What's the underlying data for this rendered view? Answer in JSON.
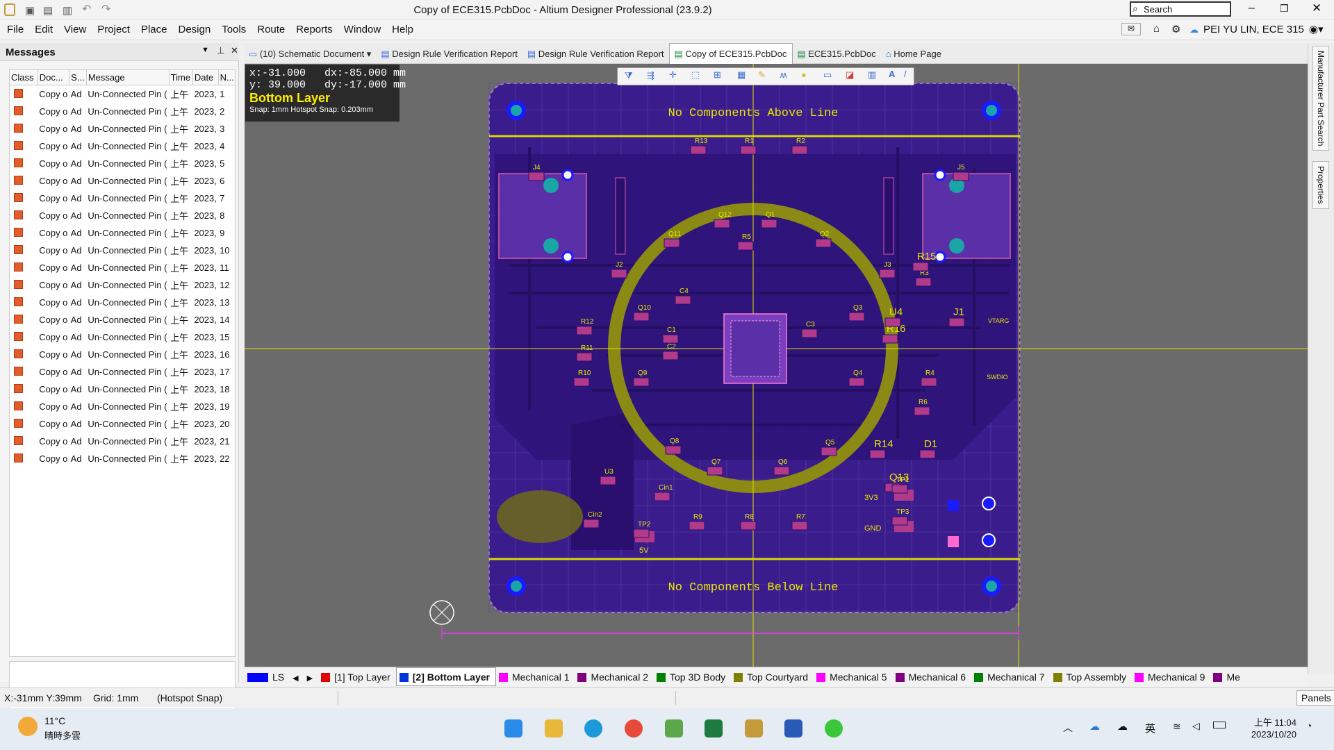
{
  "window": {
    "title": "Copy of ECE315.PcbDoc - Altium Designer Professional (23.9.2)",
    "search_placeholder": "Search"
  },
  "menu": [
    "File",
    "Edit",
    "View",
    "Project",
    "Place",
    "Design",
    "Tools",
    "Route",
    "Reports",
    "Window",
    "Help"
  ],
  "user": "PEI YU LIN, ECE 315",
  "messages_panel": {
    "title": "Messages",
    "columns": [
      "Class",
      "Doc...",
      "S...",
      "Message",
      "Time",
      "Date",
      "N..."
    ],
    "rows": [
      {
        "doc": "Copy o",
        "src": "Ad",
        "msg": "Un-Connected Pin (",
        "time": "上午",
        "date": "2023,",
        "n": "1"
      },
      {
        "doc": "Copy o",
        "src": "Ad",
        "msg": "Un-Connected Pin (",
        "time": "上午",
        "date": "2023,",
        "n": "2"
      },
      {
        "doc": "Copy o",
        "src": "Ad",
        "msg": "Un-Connected Pin (",
        "time": "上午",
        "date": "2023,",
        "n": "3"
      },
      {
        "doc": "Copy o",
        "src": "Ad",
        "msg": "Un-Connected Pin (",
        "time": "上午",
        "date": "2023,",
        "n": "4"
      },
      {
        "doc": "Copy o",
        "src": "Ad",
        "msg": "Un-Connected Pin (",
        "time": "上午",
        "date": "2023,",
        "n": "5"
      },
      {
        "doc": "Copy o",
        "src": "Ad",
        "msg": "Un-Connected Pin (",
        "time": "上午",
        "date": "2023,",
        "n": "6"
      },
      {
        "doc": "Copy o",
        "src": "Ad",
        "msg": "Un-Connected Pin (",
        "time": "上午",
        "date": "2023,",
        "n": "7"
      },
      {
        "doc": "Copy o",
        "src": "Ad",
        "msg": "Un-Connected Pin (",
        "time": "上午",
        "date": "2023,",
        "n": "8"
      },
      {
        "doc": "Copy o",
        "src": "Ad",
        "msg": "Un-Connected Pin (",
        "time": "上午",
        "date": "2023,",
        "n": "9"
      },
      {
        "doc": "Copy o",
        "src": "Ad",
        "msg": "Un-Connected Pin (",
        "time": "上午",
        "date": "2023,",
        "n": "10"
      },
      {
        "doc": "Copy o",
        "src": "Ad",
        "msg": "Un-Connected Pin (",
        "time": "上午",
        "date": "2023,",
        "n": "11"
      },
      {
        "doc": "Copy o",
        "src": "Ad",
        "msg": "Un-Connected Pin (",
        "time": "上午",
        "date": "2023,",
        "n": "12"
      },
      {
        "doc": "Copy o",
        "src": "Ad",
        "msg": "Un-Connected Pin (",
        "time": "上午",
        "date": "2023,",
        "n": "13"
      },
      {
        "doc": "Copy o",
        "src": "Ad",
        "msg": "Un-Connected Pin (",
        "time": "上午",
        "date": "2023,",
        "n": "14"
      },
      {
        "doc": "Copy o",
        "src": "Ad",
        "msg": "Un-Connected Pin (",
        "time": "上午",
        "date": "2023,",
        "n": "15"
      },
      {
        "doc": "Copy o",
        "src": "Ad",
        "msg": "Un-Connected Pin (",
        "time": "上午",
        "date": "2023,",
        "n": "16"
      },
      {
        "doc": "Copy o",
        "src": "Ad",
        "msg": "Un-Connected Pin (",
        "time": "上午",
        "date": "2023,",
        "n": "17"
      },
      {
        "doc": "Copy o",
        "src": "Ad",
        "msg": "Un-Connected Pin (",
        "time": "上午",
        "date": "2023,",
        "n": "18"
      },
      {
        "doc": "Copy o",
        "src": "Ad",
        "msg": "Un-Connected Pin (",
        "time": "上午",
        "date": "2023,",
        "n": "19"
      },
      {
        "doc": "Copy o",
        "src": "Ad",
        "msg": "Un-Connected Pin (",
        "time": "上午",
        "date": "2023,",
        "n": "20"
      },
      {
        "doc": "Copy o",
        "src": "Ad",
        "msg": "Un-Connected Pin (",
        "time": "上午",
        "date": "2023,",
        "n": "21"
      },
      {
        "doc": "Copy o",
        "src": "Ad",
        "msg": "Un-Connected Pin (",
        "time": "上午",
        "date": "2023,",
        "n": "22"
      }
    ]
  },
  "doc_tabs": [
    {
      "label": "(10) Schematic Document",
      "active": false
    },
    {
      "label": "Design Rule Verification Report",
      "active": false
    },
    {
      "label": "Design Rule Verification Report",
      "active": false
    },
    {
      "label": "Copy of ECE315.PcbDoc",
      "active": true
    },
    {
      "label": "ECE315.PcbDoc",
      "active": false
    },
    {
      "label": "Home Page",
      "active": false
    }
  ],
  "hud": {
    "line1": "x:-31.000   dx:-85.000 mm",
    "line2": "y: 39.000   dy:-17.000 mm",
    "layer": "Bottom Layer",
    "snap": "Snap: 1mm Hotspot Snap: 0.203mm"
  },
  "board": {
    "top_text": "No Components Above Line",
    "bottom_text": "No Components Below Line",
    "designators": [
      "J4",
      "J5",
      "J2",
      "J3",
      "J1",
      "R13",
      "R1",
      "R2",
      "R3",
      "R4",
      "R5",
      "R6",
      "R7",
      "R8",
      "R9",
      "R10",
      "R11",
      "R12",
      "R14",
      "R15",
      "R16",
      "Q1",
      "Q2",
      "Q3",
      "Q4",
      "Q5",
      "Q6",
      "Q7",
      "Q8",
      "Q9",
      "Q10",
      "Q11",
      "Q12",
      "Q13",
      "C1",
      "C2",
      "C3",
      "C4",
      "U3",
      "U4",
      "D1",
      "TP1",
      "TP2",
      "TP3",
      "Cin1",
      "Cin2"
    ],
    "net_labels": [
      "3V3",
      "GND",
      "5V",
      "VTARG",
      "SWDIO"
    ]
  },
  "right_side_tabs": [
    "Manufacturer Part Search",
    "Properties"
  ],
  "layer_tabs": [
    {
      "label": "LS",
      "color": "#0000ff"
    },
    {
      "label": "[1] Top Layer",
      "color": "#e00000"
    },
    {
      "label": "[2] Bottom Layer",
      "color": "#0033dd",
      "active": true
    },
    {
      "label": "Mechanical 1",
      "color": "#ff00ff"
    },
    {
      "label": "Mechanical 2",
      "color": "#800080"
    },
    {
      "label": "Top 3D Body",
      "color": "#008000"
    },
    {
      "label": "Top Courtyard",
      "color": "#808000"
    },
    {
      "label": "Mechanical 5",
      "color": "#ff00ff"
    },
    {
      "label": "Mechanical 6",
      "color": "#800080"
    },
    {
      "label": "Mechanical 7",
      "color": "#008000"
    },
    {
      "label": "Top Assembly",
      "color": "#808000"
    },
    {
      "label": "Mechanical 9",
      "color": "#ff00ff"
    },
    {
      "label": "Me",
      "color": "#800080"
    }
  ],
  "status": {
    "coords": "X:-31mm Y:39mm",
    "grid": "Grid: 1mm",
    "snap": "(Hotspot Snap)",
    "panels": "Panels"
  },
  "taskbar": {
    "weather_temp": "11°C",
    "weather_desc": "晴時多雲",
    "ime": "英",
    "time": "上午 11:04",
    "date": "2023/10/20"
  },
  "colors": {
    "board": "#3b1c8c",
    "board_dark": "#2a0f6e",
    "keepout": "#d8d800",
    "ring": "#8a8a14",
    "pad_teal": "#1aa6a6",
    "via_blue": "#1a1aff",
    "label_yellow": "#e8e800",
    "hud_layer": "#ffee00"
  }
}
